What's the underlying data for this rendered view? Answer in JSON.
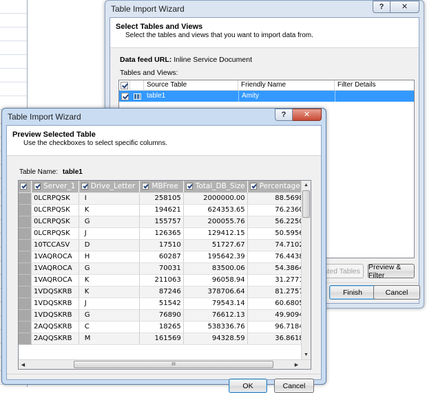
{
  "back_window": {
    "title": "Table Import Wizard",
    "help_label": "?",
    "close_label": "✕",
    "header_title": "Select Tables and Views",
    "header_subtitle": "Select the tables and views that you want to import data from.",
    "feed_label": "Data feed URL:",
    "feed_value": "Inline Service Document",
    "tables_label": "Tables and Views:",
    "columns": [
      "Source Table",
      "Friendly Name",
      "Filter Details"
    ],
    "row": {
      "source": "table1",
      "friendly": "Amity",
      "filter": ""
    },
    "select_related_label": "ated Tables",
    "preview_filter_label": "Preview & Filter",
    "finish_label": "Finish",
    "cancel_label": "Cancel"
  },
  "front_window": {
    "title": "Table Import Wizard",
    "help_label": "?",
    "close_label": "✕",
    "header_title": "Preview Selected Table",
    "header_subtitle": "Use the checkboxes to select specific columns.",
    "table_name_label": "Table Name:",
    "table_name_value": "table1",
    "columns": [
      "Server_1",
      "Drive_Letter",
      "MBFree",
      "Total_DB_Size",
      "Percentage"
    ],
    "rows": [
      [
        "0LCRPQSK",
        "I",
        "258105",
        "2000000.00",
        "88.56980"
      ],
      [
        "0LCRPQSK",
        "K",
        "194621",
        "624353.65",
        "76.23600"
      ],
      [
        "0LCRPQSK",
        "G",
        "155757",
        "200055.76",
        "56.22500"
      ],
      [
        "0LCRPQSK",
        "J",
        "126365",
        "129412.15",
        "50.59560"
      ],
      [
        "10TCCASV",
        "D",
        "17510",
        "51727.67",
        "74.71020"
      ],
      [
        "1VAQROCA",
        "H",
        "60287",
        "195642.39",
        "76.44380"
      ],
      [
        "1VAQROCA",
        "G",
        "70031",
        "83500.06",
        "54.38640"
      ],
      [
        "1VAQROCA",
        "K",
        "211063",
        "96058.94",
        "31.27710"
      ],
      [
        "1VDQSKRB",
        "K",
        "87246",
        "378706.64",
        "81.27570"
      ],
      [
        "1VDQSKRB",
        "J",
        "51542",
        "79543.14",
        "60.68050"
      ],
      [
        "1VDQSKRB",
        "G",
        "76890",
        "76612.13",
        "49.90940"
      ],
      [
        "2AQQSKRB",
        "C",
        "18265",
        "538336.76",
        "96.71840"
      ],
      [
        "2AQQSKRB",
        "M",
        "161569",
        "94328.59",
        "36.86180"
      ]
    ],
    "hscroll_grip": "III",
    "ok_label": "OK",
    "cancel_label": "Cancel"
  }
}
